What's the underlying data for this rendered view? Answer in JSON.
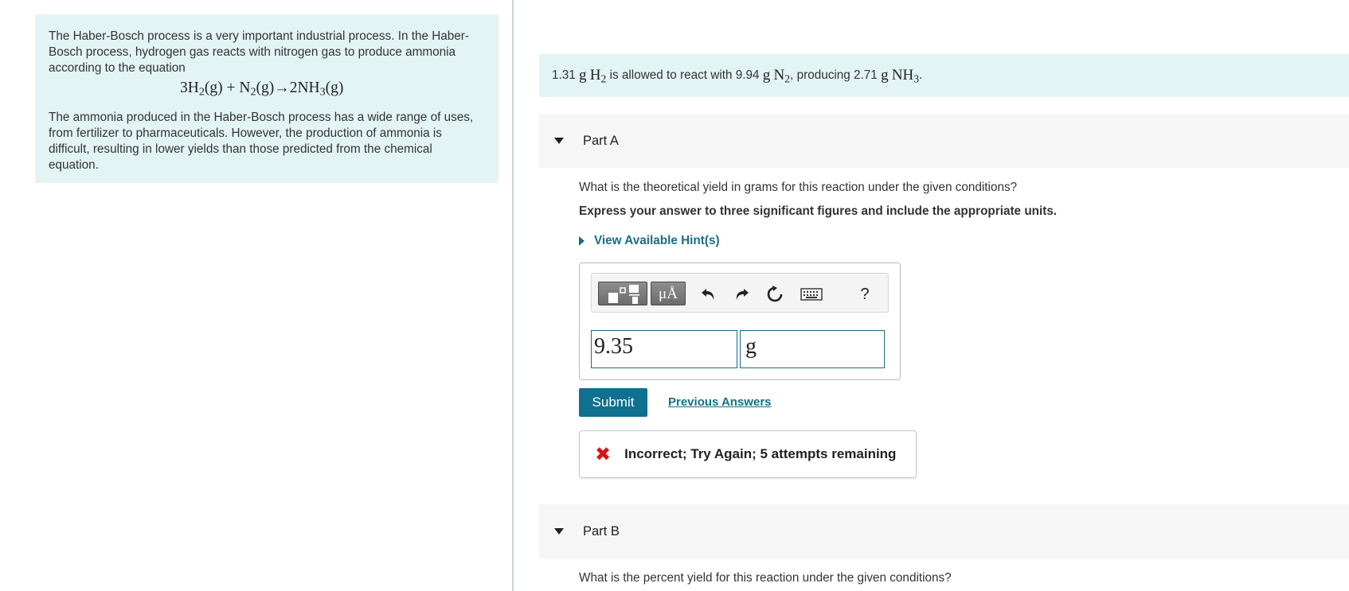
{
  "intro": {
    "para1": "The Haber-Bosch process is a very important industrial process. In the Haber-Bosch process, hydrogen gas reacts with nitrogen gas to produce ammonia according to the equation",
    "equation": {
      "r1_coef": "3H",
      "r1_sub": "2",
      "r1_state": "(g) + N",
      "r2_sub": "2",
      "r2_state": "(g)→2NH",
      "p_sub": "3",
      "p_state": "(g)"
    },
    "para2": "The ammonia produced in the Haber-Bosch process has a wide range of uses, from fertilizer to pharmaceuticals. However, the production of ammonia is difficult, resulting in lower yields than those predicted from the chemical equation."
  },
  "given": {
    "mass_h2": "1.31",
    "unit_g": "g",
    "h2": "H",
    "h2_sub": "2",
    "text1": "is allowed to react with",
    "mass_n2": "9.94",
    "n2": "N",
    "n2_sub": "2",
    "text2": ", producing",
    "mass_nh3": "2.71",
    "nh3": "NH",
    "nh3_sub": "3",
    "end": "."
  },
  "partA": {
    "label": "Part A",
    "question": "What is the theoretical yield in grams for this reaction under the given conditions?",
    "instruction": "Express your answer to three significant figures and include the appropriate units.",
    "hint": "View Available Hint(s)",
    "toolbar": {
      "units_label": "μÅ",
      "icons": [
        "templates-icon",
        "units-icon",
        "undo-icon",
        "redo-icon",
        "reset-icon",
        "keyboard-icon",
        "help-icon"
      ],
      "help_label": "?"
    },
    "value": "9.35",
    "unit": "g",
    "submit": "Submit",
    "previous": "Previous Answers",
    "feedback": "Incorrect; Try Again; 5 attempts remaining",
    "feedback_icon": "✖",
    "feedback_color": "#d4161c"
  },
  "partB": {
    "label": "Part B",
    "question": "What is the percent yield for this reaction under the given conditions?"
  },
  "colors": {
    "panel_bg": "#e3f4f5",
    "accent": "#0f7090",
    "link": "#1a6d86"
  }
}
